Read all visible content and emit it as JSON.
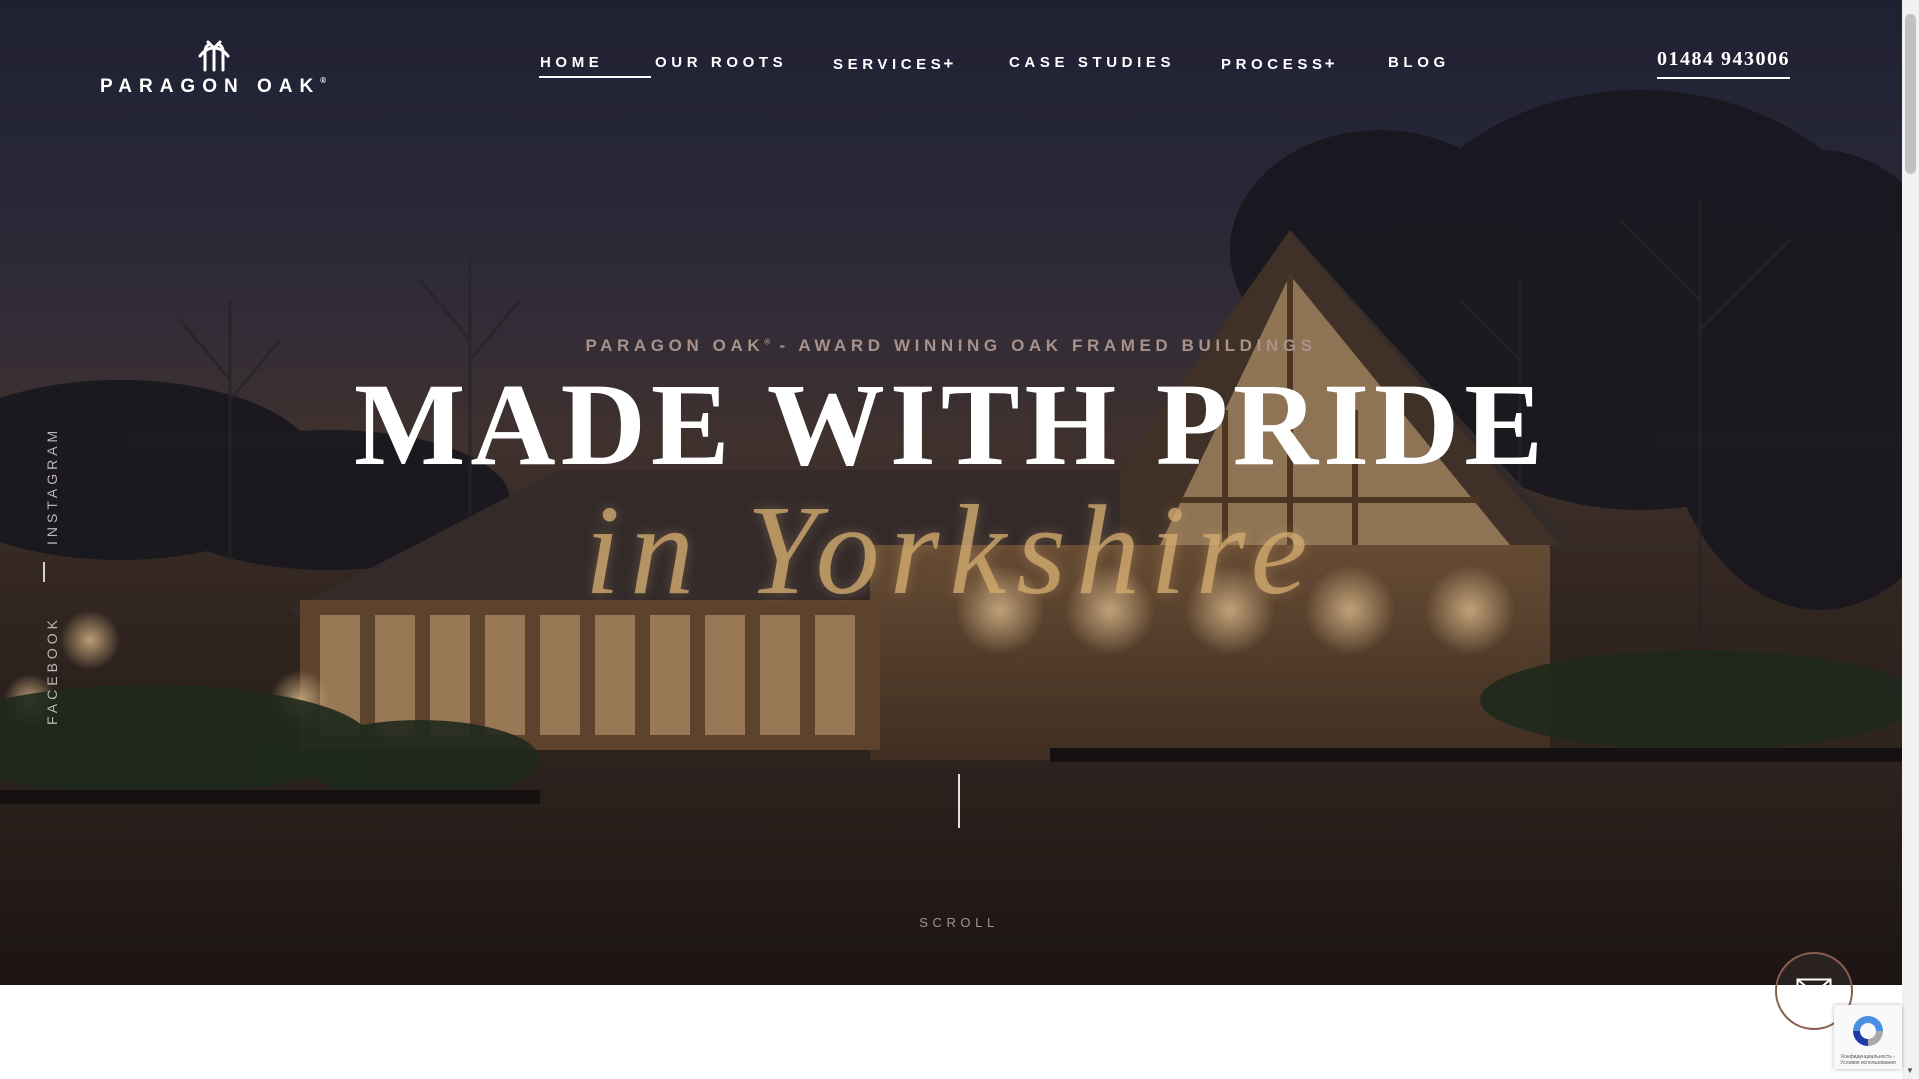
{
  "header": {
    "logo_text": "PARAGON OAK",
    "logo_reg": "®",
    "logo_icon": "tree-logo-icon",
    "nav": [
      {
        "label": "HOME",
        "active": true,
        "expandable": false
      },
      {
        "label": "OUR ROOTS",
        "active": false,
        "expandable": false
      },
      {
        "label": "SERVICES",
        "active": false,
        "expandable": true
      },
      {
        "label": "CASE STUDIES",
        "active": false,
        "expandable": false
      },
      {
        "label": "PROCESS",
        "active": false,
        "expandable": true
      },
      {
        "label": "BLOG",
        "active": false,
        "expandable": false
      }
    ],
    "expand_symbol": "+",
    "phone": "01484 943006"
  },
  "social": {
    "instagram": "INSTAGRAM",
    "facebook": "FACEBOOK"
  },
  "hero": {
    "kicker_brand": "PARAGON OAK",
    "kicker_reg": "®",
    "kicker_rest": " - AWARD WINNING OAK FRAMED BUILDINGS",
    "headline": "MADE WITH PRIDE",
    "subline": "in Yorkshire",
    "scroll_label": "SCROLL"
  },
  "contact": {
    "icon": "envelope-icon"
  },
  "recaptcha": {
    "text": "Конфиденциальность - Условия использования"
  },
  "colors": {
    "accent_border": "#8a5d4e",
    "subline_gold": "#d2aa6e",
    "kicker": "#a8928a"
  }
}
